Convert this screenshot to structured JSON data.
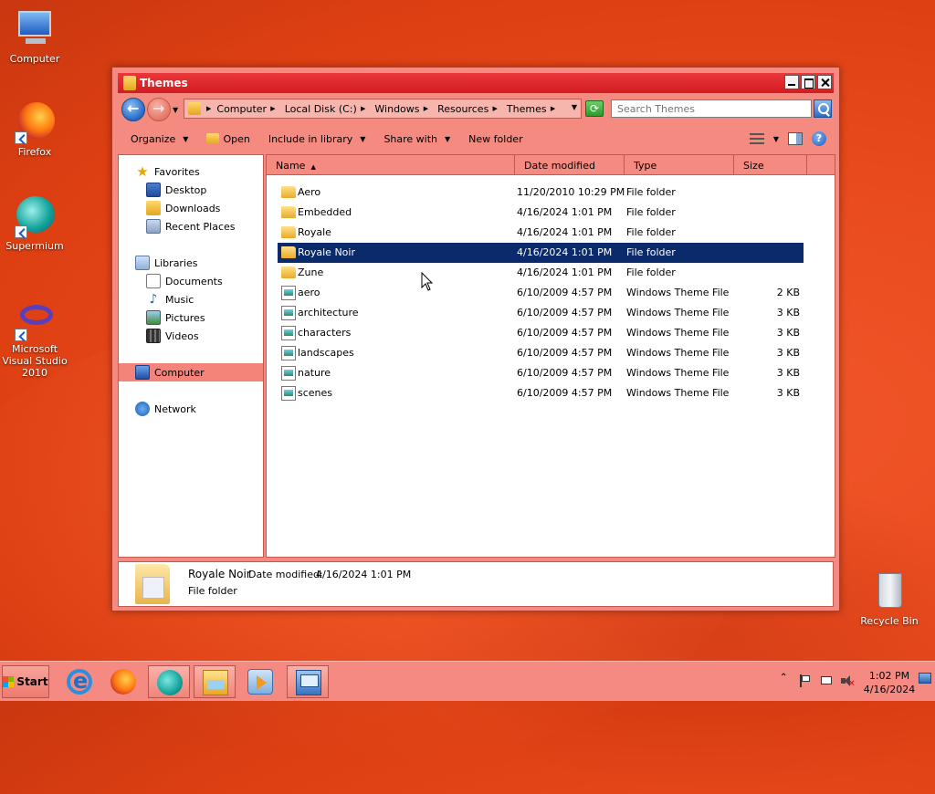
{
  "desktop": {
    "icons": [
      {
        "label": "Computer"
      },
      {
        "label": "Firefox"
      },
      {
        "label": "Supermium"
      },
      {
        "label": "Microsoft Visual Studio 2010"
      },
      {
        "label": "Recycle Bin"
      }
    ]
  },
  "window": {
    "title": "Themes",
    "address": {
      "crumbs": [
        "Computer",
        "Local Disk (C:)",
        "Windows",
        "Resources",
        "Themes"
      ]
    },
    "search": {
      "placeholder": "Search Themes"
    },
    "toolbar": {
      "organize": "Organize",
      "open": "Open",
      "include": "Include in library",
      "share": "Share with",
      "new_folder": "New folder"
    },
    "nav": {
      "favorites": "Favorites",
      "desktop": "Desktop",
      "downloads": "Downloads",
      "recent": "Recent Places",
      "libraries": "Libraries",
      "documents": "Documents",
      "music": "Music",
      "pictures": "Pictures",
      "videos": "Videos",
      "computer": "Computer",
      "network": "Network"
    },
    "columns": {
      "name": "Name",
      "date": "Date modified",
      "type": "Type",
      "size": "Size"
    },
    "files": [
      {
        "name": "Aero",
        "date": "11/20/2010 10:29 PM",
        "type": "File folder",
        "size": ""
      },
      {
        "name": "Embedded",
        "date": "4/16/2024 1:01 PM",
        "type": "File folder",
        "size": ""
      },
      {
        "name": "Royale",
        "date": "4/16/2024 1:01 PM",
        "type": "File folder",
        "size": ""
      },
      {
        "name": "Royale Noir",
        "date": "4/16/2024 1:01 PM",
        "type": "File folder",
        "size": ""
      },
      {
        "name": "Zune",
        "date": "4/16/2024 1:01 PM",
        "type": "File folder",
        "size": ""
      },
      {
        "name": "aero",
        "date": "6/10/2009 4:57 PM",
        "type": "Windows Theme File",
        "size": "2 KB"
      },
      {
        "name": "architecture",
        "date": "6/10/2009 4:57 PM",
        "type": "Windows Theme File",
        "size": "3 KB"
      },
      {
        "name": "characters",
        "date": "6/10/2009 4:57 PM",
        "type": "Windows Theme File",
        "size": "3 KB"
      },
      {
        "name": "landscapes",
        "date": "6/10/2009 4:57 PM",
        "type": "Windows Theme File",
        "size": "3 KB"
      },
      {
        "name": "nature",
        "date": "6/10/2009 4:57 PM",
        "type": "Windows Theme File",
        "size": "3 KB"
      },
      {
        "name": "scenes",
        "date": "6/10/2009 4:57 PM",
        "type": "Windows Theme File",
        "size": "3 KB"
      }
    ],
    "details": {
      "name": "Royale Noir",
      "date_label": "Date modified:",
      "date_value": "4/16/2024 1:01 PM",
      "type": "File folder"
    }
  },
  "taskbar": {
    "start_label": "Start",
    "clock_time": "1:02 PM",
    "clock_date": "4/16/2024"
  },
  "colors": {
    "title_bar": "#d31c22",
    "window_frame": "#f48a80",
    "selection": "#0a2a6b",
    "taskbar": "#f58a82"
  }
}
